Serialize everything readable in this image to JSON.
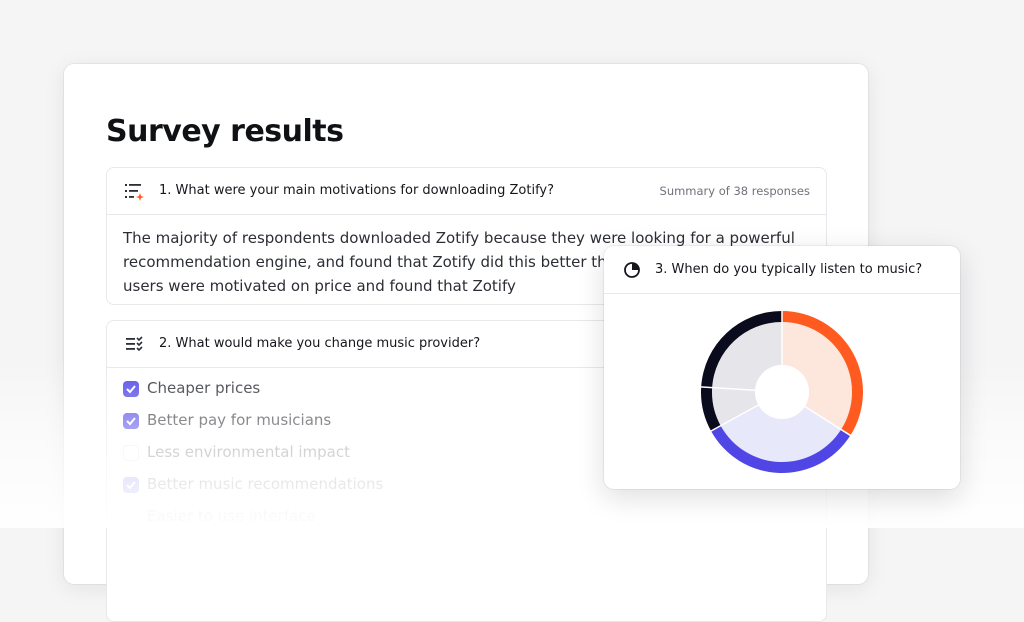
{
  "page": {
    "title": "Survey results"
  },
  "q1": {
    "title": "1. What were your main motivations for downloading Zotify?",
    "meta": "Summary of 38 responses",
    "icon": "list-sparkle-icon",
    "summary": "The majority of respondents downloaded Zotify because they were looking for a powerful recommendation engine, and found that Zotify did this better than other services. Some users were motivated on price and found that Zotify"
  },
  "q2": {
    "title": "2. What would make you change music provider?",
    "icon": "checklist-icon",
    "options": [
      {
        "label": "Cheaper prices",
        "checked": true
      },
      {
        "label": "Better pay for musicians",
        "checked": true
      },
      {
        "label": "Less environmental impact",
        "checked": false
      },
      {
        "label": "Better music recommendations",
        "checked": true
      },
      {
        "label": "Easier to use interface",
        "checked": false
      }
    ]
  },
  "q3": {
    "title": "3. When do you typically listen to music?",
    "icon": "pie-chart-icon"
  },
  "chart_data": {
    "type": "pie",
    "title": "",
    "values": [
      34,
      33,
      9,
      24
    ],
    "outer_colors": [
      "#ff5a1f",
      "#4f46e5",
      "#0b0b1e",
      "#0b0b1e"
    ],
    "inner_colors": [
      "#fde7dc",
      "#e8e8fb",
      "#e5e5ea",
      "#e5e5ea"
    ]
  }
}
